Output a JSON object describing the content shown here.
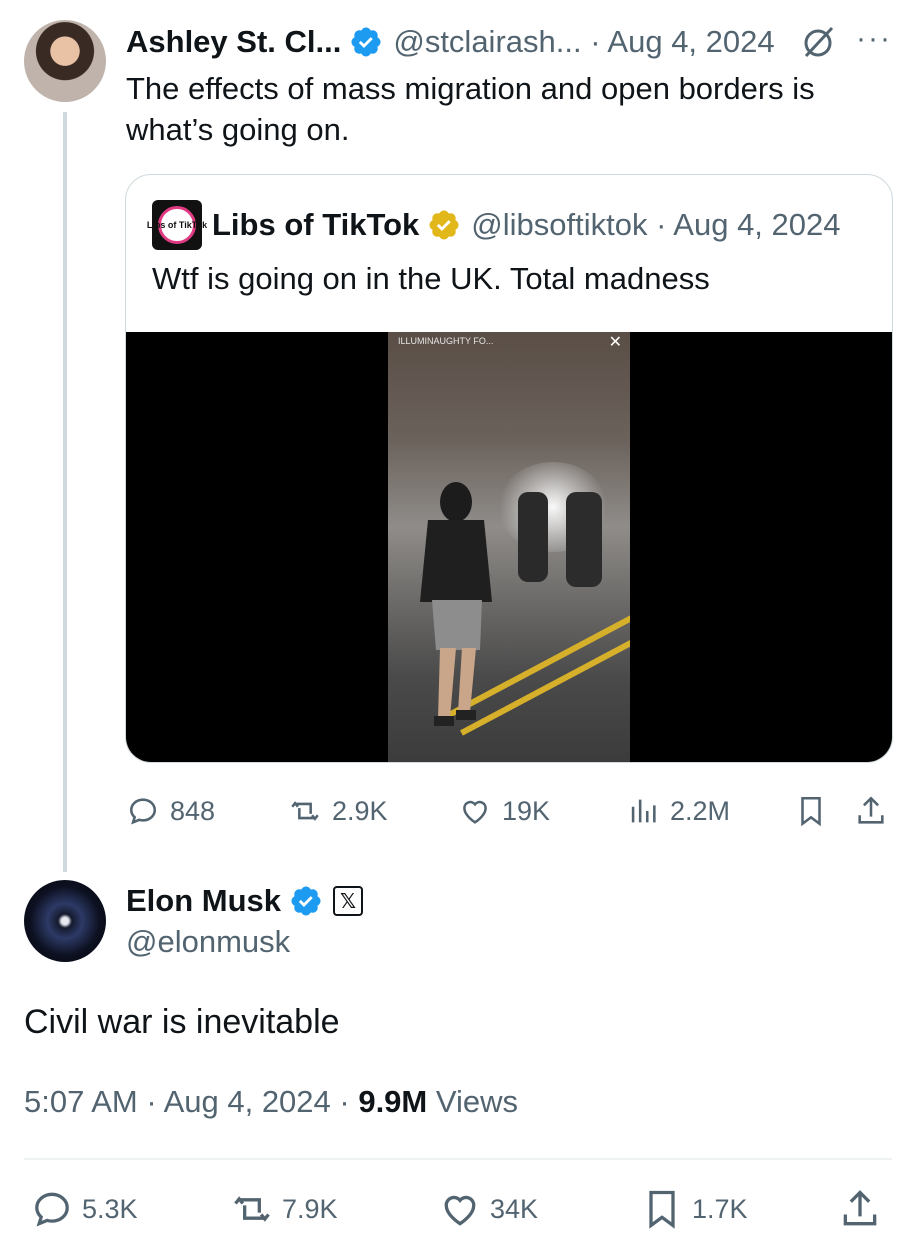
{
  "parent_tweet": {
    "author_name": "Ashley St. Cl...",
    "handle_date": "@stclairash... · Aug 4, 2024",
    "text": "The effects of mass migration and open borders is what’s going on.",
    "more_label": "···",
    "quoted": {
      "author_name": "Libs of TikTok",
      "handle_date": "@libsoftiktok · Aug 4, 2024",
      "text": "Wtf is going on in the UK. Total madness",
      "avatar_label": "Libs of TikTok",
      "video_overlay": "ILLUMINAUGHTY FO...",
      "video_close": "✕"
    },
    "actions": {
      "replies": "848",
      "reposts": "2.9K",
      "likes": "19K",
      "views": "2.2M"
    }
  },
  "main_tweet": {
    "author_name": "Elon Musk",
    "handle": "@elonmusk",
    "x_badge": "𝕏",
    "text": "Civil war is inevitable",
    "timestamp": "5:07 AM · Aug 4, 2024 · ",
    "views_count": "9.9M",
    "views_label": " Views",
    "actions": {
      "replies": "5.3K",
      "reposts": "7.9K",
      "likes": "34K",
      "bookmarks": "1.7K"
    }
  },
  "colors": {
    "verified_blue": "#1d9bf0",
    "verified_gold": "#e2b719",
    "secondary_text": "#536471",
    "border": "#cfd9de"
  },
  "icons": [
    "verified-badge-icon",
    "grok-icon",
    "more-icon",
    "reply-icon",
    "repost-icon",
    "like-icon",
    "views-icon",
    "bookmark-icon",
    "share-icon"
  ]
}
